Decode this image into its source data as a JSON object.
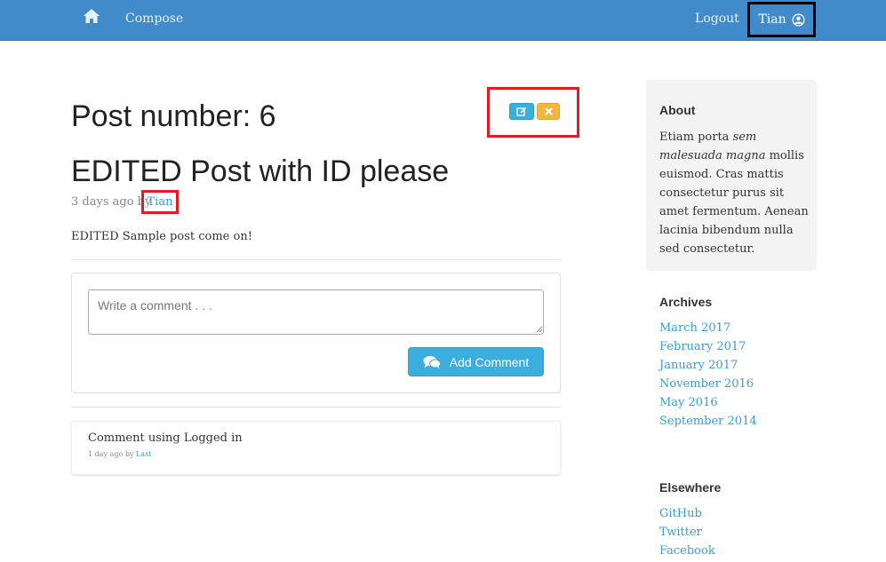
{
  "nav": {
    "compose": "Compose",
    "logout": "Logout",
    "user": "Tian"
  },
  "post": {
    "heading": "Post number: 6",
    "title": "EDITED Post with ID please",
    "meta_prefix": "3 days ago by",
    "author": "Tian",
    "body": "EDITED Sample post come on!"
  },
  "comment_form": {
    "placeholder": "Write a comment . . .",
    "button": "Add Comment"
  },
  "comments": [
    {
      "text": "Comment using Logged in",
      "meta_prefix": "1 day ago by",
      "author": "Last"
    }
  ],
  "sidebar": {
    "about_heading": "About",
    "about_text_parts": [
      "Etiam porta ",
      "sem malesuada magna",
      " mollis euismod. Cras mattis consectetur purus sit amet fermentum. Aenean lacinia bibendum nulla sed consectetur."
    ],
    "archives_heading": "Archives",
    "archives": [
      "March 2017",
      "February 2017",
      "January 2017",
      "November 2016",
      "May 2016",
      "September 2014"
    ],
    "elsewhere_heading": "Elsewhere",
    "elsewhere": [
      "GitHub",
      "Twitter",
      "Facebook"
    ]
  },
  "colors": {
    "navbar": "#428bca",
    "primary_button": "#3aaedc",
    "warning_button": "#f0b63e",
    "link": "#3a9bd5",
    "highlight_red": "#e31b23"
  },
  "icons": [
    "home-icon",
    "user-circle-icon",
    "edit-icon",
    "times-icon",
    "comments-icon"
  ]
}
